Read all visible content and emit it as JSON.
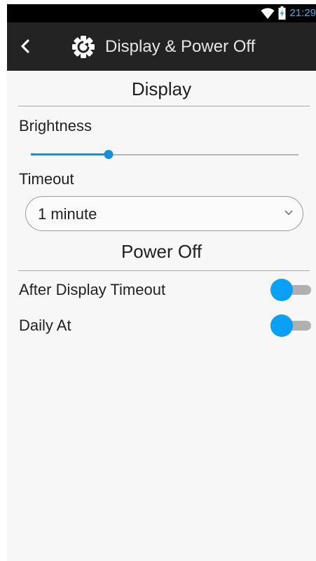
{
  "status_bar": {
    "time": "21:29",
    "wifi_icon": "wifi-icon",
    "battery_icon": "battery-icon"
  },
  "header": {
    "title": "Display & Power Off",
    "back_icon": "chevron-left-icon",
    "settings_icon": "gear-icon"
  },
  "display_section": {
    "title": "Display",
    "brightness": {
      "label": "Brightness",
      "value_fraction": 0.29
    },
    "timeout": {
      "label": "Timeout",
      "selected": "1 minute",
      "chevron_icon": "chevron-down-icon"
    }
  },
  "power_off_section": {
    "title": "Power Off",
    "after_display_timeout": {
      "label": "After Display Timeout",
      "enabled": false
    },
    "daily_at": {
      "label": "Daily At",
      "enabled": false
    }
  },
  "colors": {
    "accent": "#0aa0f5",
    "slider": "#1a8fd6",
    "status_time": "#33b5e5",
    "app_bar": "#232323",
    "background": "#f7f7f7"
  }
}
